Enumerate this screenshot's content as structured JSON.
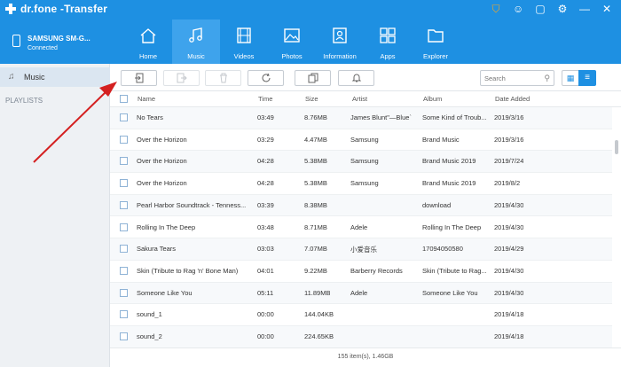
{
  "app": {
    "brand": "dr.fone",
    "title": "-Transfer"
  },
  "window_icons": [
    "cart-icon",
    "user-icon",
    "feedback-icon",
    "settings-icon",
    "minimize-icon",
    "close-icon"
  ],
  "device": {
    "name": "SAMSUNG SM-G...",
    "status": "Connected"
  },
  "nav_tabs": [
    {
      "label": "Home",
      "icon": "home-icon",
      "active": false
    },
    {
      "label": "Music",
      "icon": "music-icon",
      "active": true
    },
    {
      "label": "Videos",
      "icon": "film-icon",
      "active": false
    },
    {
      "label": "Photos",
      "icon": "photo-icon",
      "active": false
    },
    {
      "label": "Information",
      "icon": "contact-icon",
      "active": false
    },
    {
      "label": "Apps",
      "icon": "apps-icon",
      "active": false
    },
    {
      "label": "Explorer",
      "icon": "folder-icon",
      "active": false
    }
  ],
  "sidebar": {
    "music_label": "Music",
    "playlists_label": "PLAYLISTS"
  },
  "toolbar": {
    "search_placeholder": "Search"
  },
  "columns": {
    "name": "Name",
    "time": "Time",
    "size": "Size",
    "artist": "Artist",
    "album": "Album",
    "date_added": "Date Added"
  },
  "rows": [
    {
      "name": "No Tears",
      "time": "03:49",
      "size": "8.76MB",
      "artist": "James Blunt\"—Blue`",
      "album": "Some Kind of Troub...",
      "date": "2019/3/16"
    },
    {
      "name": "Over the Horizon",
      "time": "03:29",
      "size": "4.47MB",
      "artist": "Samsung",
      "album": "Brand Music",
      "date": "2019/3/16"
    },
    {
      "name": "Over the Horizon",
      "time": "04:28",
      "size": "5.38MB",
      "artist": "Samsung",
      "album": "Brand Music 2019",
      "date": "2019/7/24"
    },
    {
      "name": "Over the Horizon",
      "time": "04:28",
      "size": "5.38MB",
      "artist": "Samsung",
      "album": "Brand Music 2019",
      "date": "2019/8/2"
    },
    {
      "name": "Pearl Harbor Soundtrack - Tenness...",
      "time": "03:39",
      "size": "8.38MB",
      "artist": "",
      "album": "download",
      "date": "2019/4/30"
    },
    {
      "name": "Rolling In The Deep",
      "time": "03:48",
      "size": "8.71MB",
      "artist": "Adele",
      "album": "Rolling In The Deep",
      "date": "2019/4/30"
    },
    {
      "name": "Sakura Tears",
      "time": "03:03",
      "size": "7.07MB",
      "artist": "小爱音乐",
      "album": "17094050580",
      "date": "2019/4/29"
    },
    {
      "name": "Skin (Tribute to Rag 'n' Bone Man)",
      "time": "04:01",
      "size": "9.22MB",
      "artist": "Barberry Records",
      "album": "Skin (Tribute to Rag...",
      "date": "2019/4/30"
    },
    {
      "name": "Someone Like You",
      "time": "05:11",
      "size": "11.89MB",
      "artist": "Adele",
      "album": "Someone Like You",
      "date": "2019/4/30"
    },
    {
      "name": "sound_1",
      "time": "00:00",
      "size": "144.04KB",
      "artist": "",
      "album": "",
      "date": "2019/4/18"
    },
    {
      "name": "sound_2",
      "time": "00:00",
      "size": "224.65KB",
      "artist": "",
      "album": "",
      "date": "2019/4/18"
    }
  ],
  "footer": {
    "summary": "155 item(s), 1.46GB"
  },
  "colors": {
    "header_blue": "#1e90e2",
    "active_tab": "#3ea3ec",
    "annotation_arrow": "#d42020"
  }
}
